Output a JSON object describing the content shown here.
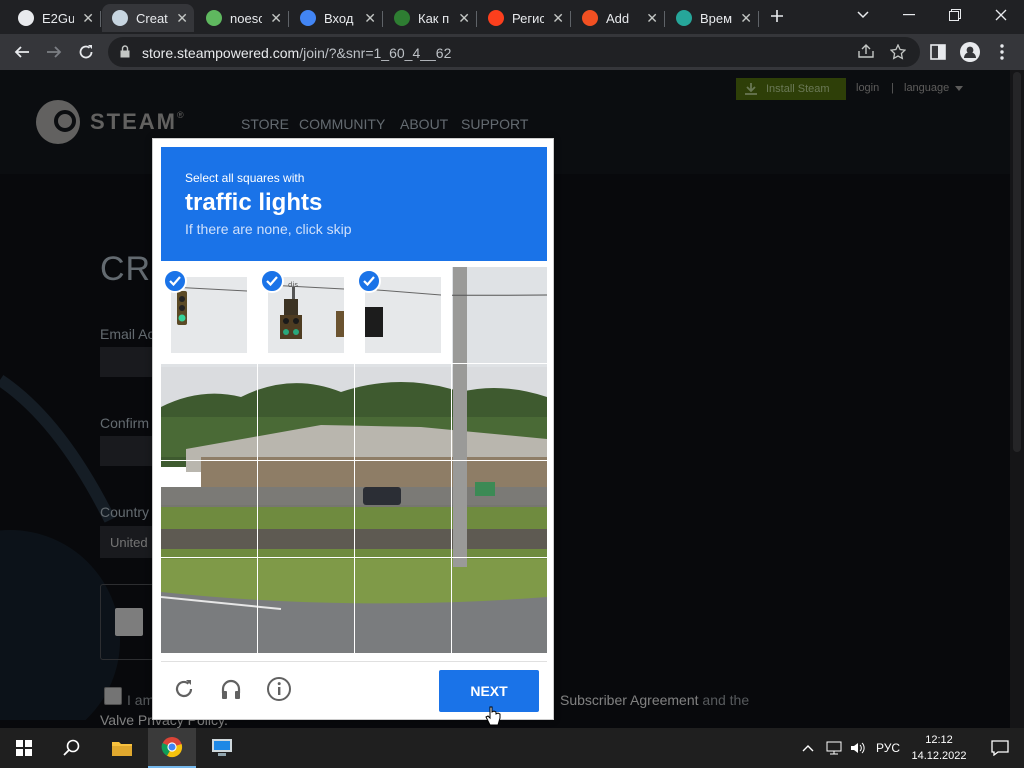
{
  "browser": {
    "tabs": [
      {
        "title": "E2Gu",
        "favicon": "globe-icon",
        "color": "#e8eaed"
      },
      {
        "title": "Creat",
        "favicon": "steam-icon",
        "color": "#c7d5e0",
        "active": true
      },
      {
        "title": "noesc",
        "favicon": "v-icon",
        "color": "#5fb85f"
      },
      {
        "title": "Вход",
        "favicon": "google-icon",
        "color": "#4285f4"
      },
      {
        "title": "Как п",
        "favicon": "money-icon",
        "color": "#2e7d32"
      },
      {
        "title": "Регис",
        "favicon": "yandex-icon",
        "color": "#fc3f1d"
      },
      {
        "title": "Add ",
        "favicon": "microsoft-icon",
        "color": "#f25022"
      },
      {
        "title": "Врем",
        "favicon": "tempmail-icon",
        "color": "#26a69a"
      }
    ],
    "url_host": "store.steampowered.com",
    "url_path": "/join/?&snr=1_60_4__62"
  },
  "steam": {
    "install_label": "Install Steam",
    "login_label": "login",
    "separator": "|",
    "language_label": "language",
    "logo_text": "STEAM",
    "logo_mark": "®",
    "nav": [
      "STORE",
      "COMMUNITY",
      "ABOUT",
      "SUPPORT"
    ],
    "page_title": "CRE",
    "email_label": "Email Ac",
    "confirm_label": "Confirm",
    "country_label": "Country",
    "country_value": "United",
    "agree_prefix": "I am",
    "agree_link": "Subscriber Agreement",
    "agree_suffix": "and the",
    "privacy_link": "Valve Privacy Policy."
  },
  "captcha": {
    "instruction": "Select all squares with",
    "target": "traffic lights",
    "hint": "If there are none, click skip",
    "selected_tiles": [
      0,
      1,
      2
    ],
    "next_label": "NEXT",
    "reload_icon": "reload-icon",
    "audio_icon": "headphones-icon",
    "info_icon": "info-icon"
  },
  "taskbar": {
    "apps": [
      "windows-start-icon",
      "search-icon",
      "file-explorer-icon",
      "chrome-icon",
      "network-computer-icon"
    ],
    "language": "РУС",
    "time": "12:12",
    "date": "14.12.2022"
  }
}
